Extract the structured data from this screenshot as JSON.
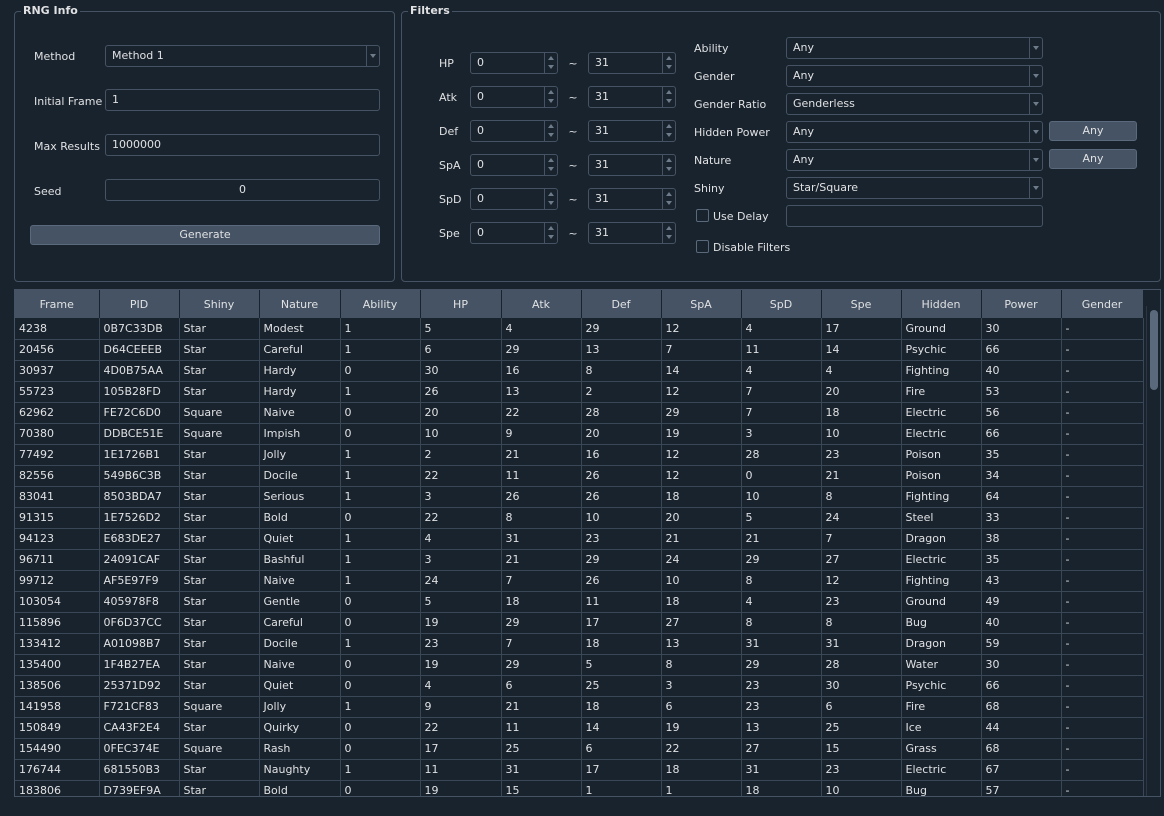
{
  "rng_info": {
    "title": "RNG Info",
    "method_label": "Method",
    "method_value": "Method 1",
    "initial_frame_label": "Initial Frame",
    "initial_frame_value": "1",
    "max_results_label": "Max Results",
    "max_results_value": "1000000",
    "seed_label": "Seed",
    "seed_value": "0",
    "generate_label": "Generate"
  },
  "filters": {
    "title": "Filters",
    "stats": [
      {
        "label": "HP",
        "min": "0",
        "max": "31"
      },
      {
        "label": "Atk",
        "min": "0",
        "max": "31"
      },
      {
        "label": "Def",
        "min": "0",
        "max": "31"
      },
      {
        "label": "SpA",
        "min": "0",
        "max": "31"
      },
      {
        "label": "SpD",
        "min": "0",
        "max": "31"
      },
      {
        "label": "Spe",
        "min": "0",
        "max": "31"
      }
    ],
    "tilde": "~",
    "ability_label": "Ability",
    "ability_value": "Any",
    "gender_label": "Gender",
    "gender_value": "Any",
    "gender_ratio_label": "Gender Ratio",
    "gender_ratio_value": "Genderless",
    "hidden_power_label": "Hidden Power",
    "hidden_power_value": "Any",
    "hidden_power_button": "Any",
    "nature_label": "Nature",
    "nature_value": "Any",
    "nature_button": "Any",
    "shiny_label": "Shiny",
    "shiny_value": "Star/Square",
    "use_delay_label": "Use Delay",
    "use_delay_value": "",
    "disable_filters_label": "Disable Filters"
  },
  "table": {
    "headers": [
      "Frame",
      "PID",
      "Shiny",
      "Nature",
      "Ability",
      "HP",
      "Atk",
      "Def",
      "SpA",
      "SpD",
      "Spe",
      "Hidden",
      "Power",
      "Gender"
    ],
    "rows": [
      [
        "4238",
        "0B7C33DB",
        "Star",
        "Modest",
        "1",
        "5",
        "4",
        "29",
        "12",
        "4",
        "17",
        "Ground",
        "30",
        "-"
      ],
      [
        "20456",
        "D64CEEEB",
        "Star",
        "Careful",
        "1",
        "6",
        "29",
        "13",
        "7",
        "11",
        "14",
        "Psychic",
        "66",
        "-"
      ],
      [
        "30937",
        "4D0B75AA",
        "Star",
        "Hardy",
        "0",
        "30",
        "16",
        "8",
        "14",
        "4",
        "4",
        "Fighting",
        "40",
        "-"
      ],
      [
        "55723",
        "105B28FD",
        "Star",
        "Hardy",
        "1",
        "26",
        "13",
        "2",
        "12",
        "7",
        "20",
        "Fire",
        "53",
        "-"
      ],
      [
        "62962",
        "FE72C6D0",
        "Square",
        "Naive",
        "0",
        "20",
        "22",
        "28",
        "29",
        "7",
        "18",
        "Electric",
        "56",
        "-"
      ],
      [
        "70380",
        "DDBCE51E",
        "Square",
        "Impish",
        "0",
        "10",
        "9",
        "20",
        "19",
        "3",
        "10",
        "Electric",
        "66",
        "-"
      ],
      [
        "77492",
        "1E1726B1",
        "Star",
        "Jolly",
        "1",
        "2",
        "21",
        "16",
        "12",
        "28",
        "23",
        "Poison",
        "35",
        "-"
      ],
      [
        "82556",
        "549B6C3B",
        "Star",
        "Docile",
        "1",
        "22",
        "11",
        "26",
        "12",
        "0",
        "21",
        "Poison",
        "34",
        "-"
      ],
      [
        "83041",
        "8503BDA7",
        "Star",
        "Serious",
        "1",
        "3",
        "26",
        "26",
        "18",
        "10",
        "8",
        "Fighting",
        "64",
        "-"
      ],
      [
        "91315",
        "1E7526D2",
        "Star",
        "Bold",
        "0",
        "22",
        "8",
        "10",
        "20",
        "5",
        "24",
        "Steel",
        "33",
        "-"
      ],
      [
        "94123",
        "E683DE27",
        "Star",
        "Quiet",
        "1",
        "4",
        "31",
        "23",
        "21",
        "21",
        "7",
        "Dragon",
        "38",
        "-"
      ],
      [
        "96711",
        "24091CAF",
        "Star",
        "Bashful",
        "1",
        "3",
        "21",
        "29",
        "24",
        "29",
        "27",
        "Electric",
        "35",
        "-"
      ],
      [
        "99712",
        "AF5E97F9",
        "Star",
        "Naive",
        "1",
        "24",
        "7",
        "26",
        "10",
        "8",
        "12",
        "Fighting",
        "43",
        "-"
      ],
      [
        "103054",
        "405978F8",
        "Star",
        "Gentle",
        "0",
        "5",
        "18",
        "11",
        "18",
        "4",
        "23",
        "Ground",
        "49",
        "-"
      ],
      [
        "115896",
        "0F6D37CC",
        "Star",
        "Careful",
        "0",
        "19",
        "29",
        "17",
        "27",
        "8",
        "8",
        "Bug",
        "40",
        "-"
      ],
      [
        "133412",
        "A01098B7",
        "Star",
        "Docile",
        "1",
        "23",
        "7",
        "18",
        "13",
        "31",
        "31",
        "Dragon",
        "59",
        "-"
      ],
      [
        "135400",
        "1F4B27EA",
        "Star",
        "Naive",
        "0",
        "19",
        "29",
        "5",
        "8",
        "29",
        "28",
        "Water",
        "30",
        "-"
      ],
      [
        "138506",
        "25371D92",
        "Star",
        "Quiet",
        "0",
        "4",
        "6",
        "25",
        "3",
        "23",
        "30",
        "Psychic",
        "66",
        "-"
      ],
      [
        "141958",
        "F721CF83",
        "Square",
        "Jolly",
        "1",
        "9",
        "21",
        "18",
        "6",
        "23",
        "6",
        "Fire",
        "68",
        "-"
      ],
      [
        "150849",
        "CA43F2E4",
        "Star",
        "Quirky",
        "0",
        "22",
        "11",
        "14",
        "19",
        "13",
        "25",
        "Ice",
        "44",
        "-"
      ],
      [
        "154490",
        "0FEC374E",
        "Square",
        "Rash",
        "0",
        "17",
        "25",
        "6",
        "22",
        "27",
        "15",
        "Grass",
        "68",
        "-"
      ],
      [
        "176744",
        "681550B3",
        "Star",
        "Naughty",
        "1",
        "11",
        "31",
        "17",
        "18",
        "31",
        "23",
        "Electric",
        "67",
        "-"
      ],
      [
        "183806",
        "D739EF9A",
        "Star",
        "Bold",
        "0",
        "19",
        "15",
        "1",
        "1",
        "18",
        "10",
        "Bug",
        "57",
        "-"
      ]
    ]
  }
}
